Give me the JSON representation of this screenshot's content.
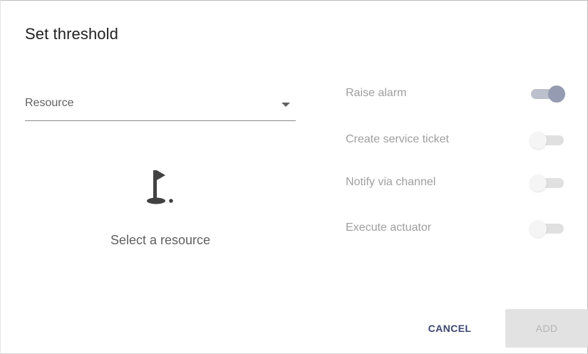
{
  "dialog": {
    "title": "Set threshold"
  },
  "resource_select": {
    "selected_value": "Resource",
    "icon": "chevron-down-icon"
  },
  "empty_state": {
    "icon": "golf-flag-icon",
    "message": "Select a resource"
  },
  "options": [
    {
      "label": "Raise alarm",
      "enabled": true
    },
    {
      "label": "Create service ticket",
      "enabled": false
    },
    {
      "label": "Notify via channel",
      "enabled": false
    },
    {
      "label": "Execute actuator",
      "enabled": false
    }
  ],
  "actions": {
    "cancel_label": "CANCEL",
    "add_label": "ADD"
  },
  "colors": {
    "accent": "#3c4670",
    "toggle_on_thumb": "#959cb1",
    "toggle_on_track": "#bbc0cc",
    "toggle_off_track": "#e0e0e0",
    "disabled_button": "#e2e2e2"
  }
}
